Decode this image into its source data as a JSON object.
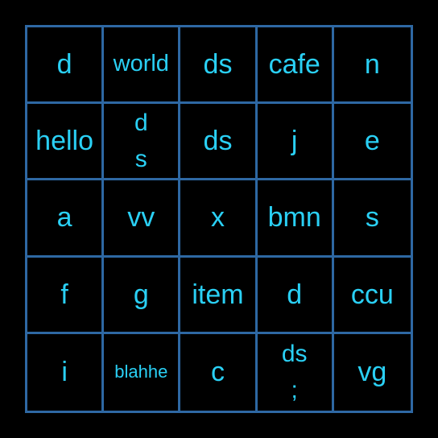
{
  "board": {
    "rows": [
      [
        {
          "text": "d",
          "size": "l"
        },
        {
          "text": "world",
          "size": "m"
        },
        {
          "text": "ds",
          "size": "l"
        },
        {
          "text": "cafe",
          "size": "l"
        },
        {
          "text": "n",
          "size": "l"
        }
      ],
      [
        {
          "text": "hello",
          "size": "l"
        },
        {
          "text": "d\ns",
          "size": "ml"
        },
        {
          "text": "ds",
          "size": "l"
        },
        {
          "text": "j",
          "size": "l"
        },
        {
          "text": "e",
          "size": "l"
        }
      ],
      [
        {
          "text": "a",
          "size": "l"
        },
        {
          "text": "vv",
          "size": "l"
        },
        {
          "text": "x",
          "size": "l"
        },
        {
          "text": "bmn",
          "size": "l"
        },
        {
          "text": "s",
          "size": "l"
        }
      ],
      [
        {
          "text": "f",
          "size": "l"
        },
        {
          "text": "g",
          "size": "l"
        },
        {
          "text": "item",
          "size": "l"
        },
        {
          "text": "d",
          "size": "l"
        },
        {
          "text": "ccu",
          "size": "l"
        }
      ],
      [
        {
          "text": "i",
          "size": "l"
        },
        {
          "text": "blahhe",
          "size": "s"
        },
        {
          "text": "c",
          "size": "l"
        },
        {
          "text": "ds\n;",
          "size": "ml"
        },
        {
          "text": "vg",
          "size": "l"
        }
      ]
    ]
  },
  "colors": {
    "background": "#000000",
    "grid_line": "#2e68a3",
    "text": "#2ad0f5"
  }
}
